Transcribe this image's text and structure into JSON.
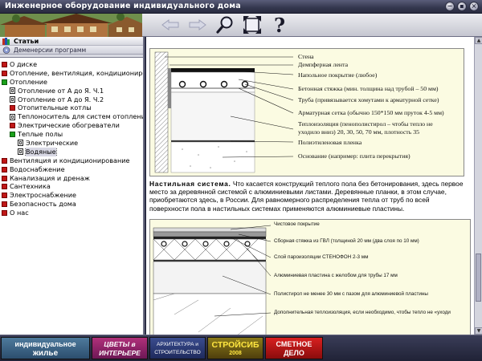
{
  "window": {
    "title": "Инженерное оборудование индивидуального дома"
  },
  "sidebar": {
    "section_title": "Статьи",
    "subsection_title": "Деменерсии программ",
    "items": [
      {
        "label": "О диске",
        "icon": "red-square",
        "indent": 0
      },
      {
        "label": "Отопление, вентиляция, кондиционирова",
        "icon": "red-square",
        "indent": 0
      },
      {
        "label": "Отопление",
        "icon": "green-square",
        "indent": 0
      },
      {
        "label": "Отопление от А до Я. Ч.1",
        "icon": "doc-icon",
        "indent": 1
      },
      {
        "label": "Отопление от А до Я. Ч.2",
        "icon": "doc-icon",
        "indent": 1
      },
      {
        "label": "Отопительные котлы",
        "icon": "red-square",
        "indent": 1
      },
      {
        "label": "Теплоноситель для систем отопления",
        "icon": "doc-icon",
        "indent": 1
      },
      {
        "label": "Электрические обогреватели",
        "icon": "red-square",
        "indent": 1
      },
      {
        "label": "Теплые полы",
        "icon": "green-square",
        "indent": 1
      },
      {
        "label": "Электрические",
        "icon": "doc-icon",
        "indent": 2
      },
      {
        "label": "Водяные",
        "icon": "doc-icon",
        "indent": 2,
        "selected": true
      },
      {
        "label": "Вентиляция и кондиционирование",
        "icon": "red-square",
        "indent": 0
      },
      {
        "label": "Водоснабжение",
        "icon": "red-square",
        "indent": 0
      },
      {
        "label": "Канализация и дренаж",
        "icon": "red-square",
        "indent": 0
      },
      {
        "label": "Сантехника",
        "icon": "red-square",
        "indent": 0
      },
      {
        "label": "Электроснабжение",
        "icon": "red-square",
        "indent": 0
      },
      {
        "label": "Безопасность дома",
        "icon": "red-square",
        "indent": 0
      },
      {
        "label": "О нас",
        "icon": "red-square",
        "indent": 0
      }
    ]
  },
  "toolbar": {
    "icons": [
      "back-arrow-icon",
      "forward-arrow-icon",
      "search-icon",
      "fullscreen-icon",
      "help-icon"
    ]
  },
  "figure1": {
    "labels": [
      "Стена",
      "Демпферная лента",
      "Напольное покрытие (любое)",
      "Бетонная стяжка (мин. толщина над трубой – 50 мм)",
      "Труба (привязывается хомутами к арматурной сетке)",
      "Арматурная сетка (обычно 150*150 мм пруток 4-5 мм)",
      "Теплоизоляция (пенополистирол – чтобы тепло не",
      "уходило вниз) 20, 30, 50, 70 мм, плотность 35",
      "Полиэтиленовая пленка",
      "Основание (например: плита перекрытия)"
    ]
  },
  "article": {
    "heading": "Настильная система.",
    "text": " Что касается конструкций теплого пола без бетонирования, здесь первое место за деревянной системой с алюминиевыми листами. Деревянные планки, в этом случае, приобретаются здесь, в России. Для равномерного распределения тепла от труб по всей поверхности пола в настильных системах применяются алюминиевые пластины."
  },
  "figure2": {
    "labels": [
      "Чистовое покрытие",
      "Сборная стяжка из ГВЛ (толщиной 20 мм (два слоя по 10 мм)",
      "Слой пароизоляции СТЕНОФОН 2-3 мм",
      "Алюминиевая пластина с желобом для трубы 17 мм",
      "Полистирол не менее 30 мм с пазом для алюминиевой пластины",
      "Дополнительная теплоизоляция, если необходимо, чтобы тепло не «уходи"
    ]
  },
  "footer": {
    "banners": [
      {
        "line1": "индивидуальное",
        "line2": "жилье"
      },
      {
        "line1": "ЦВЕТЫ в",
        "line2": "ИНТЕРЬЕРЕ"
      },
      {
        "line1": "АРХИТЕКТУРА и",
        "line2": "СТРОИТЕЛЬСТВО"
      },
      {
        "line1": "СТРОЙСИБ",
        "line2": "2008"
      },
      {
        "line1": "СМЕТНОЕ",
        "line2": "ДЕЛО"
      }
    ]
  },
  "colors": {
    "accent_red": "#c01818",
    "accent_green": "#1aa01a",
    "chrome": "#2a2d44",
    "figure_bg": "#fbfbe2"
  }
}
